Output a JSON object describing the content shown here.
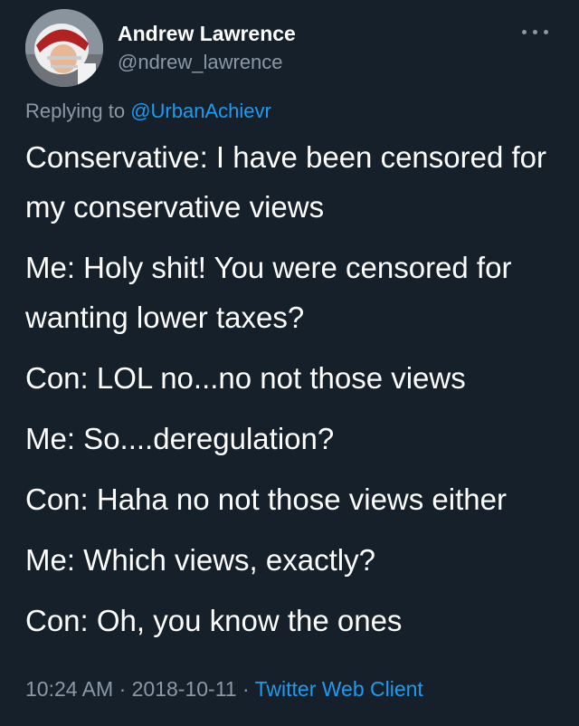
{
  "author": {
    "name": "Andrew Lawrence",
    "handle": "@ndrew_lawrence"
  },
  "reply": {
    "prefix": "Replying to ",
    "mention": "@UrbanAchievr"
  },
  "tweet": {
    "lines": [
      "Conservative: I have been censored for my conservative views",
      "Me: Holy shit! You were censored for wanting lower taxes?",
      "Con: LOL no...no not those views",
      "Me: So....deregulation?",
      "Con: Haha no not those views either",
      "Me: Which views, exactly?",
      "Con: Oh, you know the ones"
    ]
  },
  "meta": {
    "time": "10:24 AM",
    "sep1": " · ",
    "date": "2018-10-11",
    "sep2": " · ",
    "client": "Twitter Web Client"
  },
  "colors": {
    "background": "#15202b",
    "text": "#ffffff",
    "secondary": "#8b98a5",
    "link": "#1d9bf0"
  },
  "icons": {
    "avatar": "avatar-football-helmet",
    "more": "more-icon"
  }
}
